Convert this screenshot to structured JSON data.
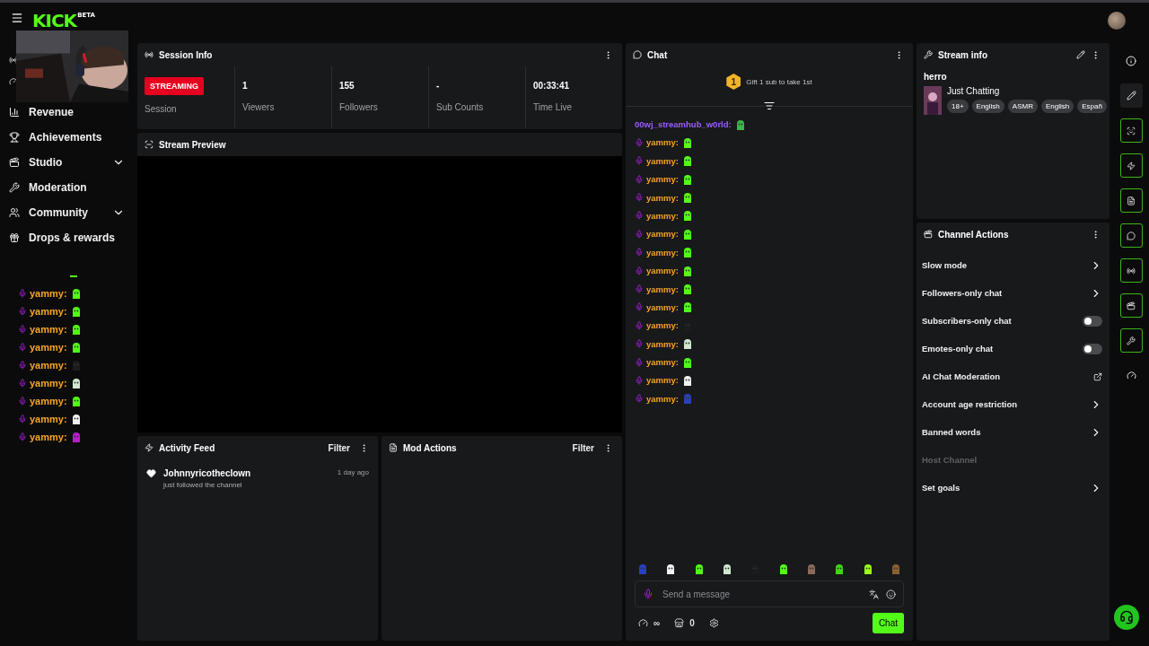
{
  "top_bar": {
    "logo": "KICK",
    "logo_badge": "BETA"
  },
  "sidebar": {
    "items": [
      {
        "label": "Revenue",
        "expandable": false
      },
      {
        "label": "Achievements",
        "expandable": false
      },
      {
        "label": "Studio",
        "expandable": true
      },
      {
        "label": "Moderation",
        "expandable": false
      },
      {
        "label": "Community",
        "expandable": true
      },
      {
        "label": "Drops & rewards",
        "expandable": false
      }
    ]
  },
  "overlay_chat": [
    {
      "user": "yammy:",
      "color": "#53fc18"
    },
    {
      "user": "yammy:",
      "color": "#53fc18"
    },
    {
      "user": "yammy:",
      "color": "#53fc18"
    },
    {
      "user": "yammy:",
      "color": "#53fc18"
    },
    {
      "user": "yammy:",
      "color": "#1c1c1c"
    },
    {
      "user": "yammy:",
      "color": "#cfe8cf"
    },
    {
      "user": "yammy:",
      "color": "#53fc18"
    },
    {
      "user": "yammy:",
      "color": "#f2f2f2"
    },
    {
      "user": "yammy:",
      "color": "#b51fc9"
    }
  ],
  "session_info": {
    "title": "Session Info",
    "stats": [
      {
        "kind": "badge",
        "value": "STREAMING",
        "label": "Session"
      },
      {
        "kind": "number",
        "value": "1",
        "label": "Viewers"
      },
      {
        "kind": "number",
        "value": "155",
        "label": "Followers"
      },
      {
        "kind": "number",
        "value": "-",
        "label": "Sub Counts"
      },
      {
        "kind": "number",
        "value": "00:33:41",
        "label": "Time Live"
      }
    ]
  },
  "stream_preview": {
    "title": "Stream Preview"
  },
  "activity_feed": {
    "title": "Activity Feed",
    "filter": "Filter",
    "items": [
      {
        "user": "Johnnyricotheclown",
        "action": "just followed the channel",
        "time": "1 day ago"
      }
    ]
  },
  "mod_actions": {
    "title": "Mod Actions",
    "filter": "Filter"
  },
  "chat": {
    "title": "Chat",
    "leaderboard": {
      "rank": "1",
      "text": "Gift 1 sub to take 1st"
    },
    "messages": [
      {
        "kind": "plain",
        "user": "00wj_streamhub_w0rld:",
        "color": "#3bb54a"
      },
      {
        "kind": "badged",
        "user": "yammy:",
        "color": "#53fc18"
      },
      {
        "kind": "badged",
        "user": "yammy:",
        "color": "#53fc18"
      },
      {
        "kind": "badged",
        "user": "yammy:",
        "color": "#53fc18"
      },
      {
        "kind": "badged",
        "user": "yammy:",
        "color": "#53fc18"
      },
      {
        "kind": "badged",
        "user": "yammy:",
        "color": "#53fc18"
      },
      {
        "kind": "badged",
        "user": "yammy:",
        "color": "#53fc18"
      },
      {
        "kind": "badged",
        "user": "yammy:",
        "color": "#53fc18"
      },
      {
        "kind": "badged",
        "user": "yammy:",
        "color": "#53fc18"
      },
      {
        "kind": "badged",
        "user": "yammy:",
        "color": "#53fc18"
      },
      {
        "kind": "badged",
        "user": "yammy:",
        "color": "#53fc18"
      },
      {
        "kind": "badged",
        "user": "yammy:",
        "color": "#1c1c1c"
      },
      {
        "kind": "badged",
        "user": "yammy:",
        "color": "#cfe8cf"
      },
      {
        "kind": "badged",
        "user": "yammy:",
        "color": "#53fc18"
      },
      {
        "kind": "badged",
        "user": "yammy:",
        "color": "#f2f2f2"
      },
      {
        "kind": "badged",
        "user": "yammy:",
        "color": "#2a3fc0"
      }
    ],
    "emote_bar": [
      {
        "color": "#2a3fc0"
      },
      {
        "color": "#f2f2f2"
      },
      {
        "color": "#53fc18"
      },
      {
        "color": "#cfe8cf"
      },
      {
        "color": "#1c1c1c"
      },
      {
        "color": "#53fc19"
      },
      {
        "color": "#8a6a5a"
      },
      {
        "color": "#3fd61a"
      },
      {
        "color": "#9cfc18"
      },
      {
        "color": "#8a6030"
      }
    ],
    "input": {
      "placeholder": "Send a message"
    },
    "points": "∞",
    "count": "0",
    "send": "Chat"
  },
  "stream_info": {
    "title": "Stream info",
    "stream_title": "herro",
    "category": "Just Chatting",
    "tags": [
      "18+",
      "English",
      "ASMR",
      "English",
      "Españ"
    ]
  },
  "channel_actions": {
    "title": "Channel Actions",
    "items": [
      {
        "kind": "chevron",
        "label": "Slow mode",
        "disabled": false
      },
      {
        "kind": "chevron",
        "label": "Followers-only chat",
        "disabled": false
      },
      {
        "kind": "toggle",
        "label": "Subscribers-only chat",
        "on": false,
        "disabled": false
      },
      {
        "kind": "toggle",
        "label": "Emotes-only chat",
        "on": false,
        "disabled": false
      },
      {
        "kind": "external",
        "label": "AI Chat Moderation",
        "disabled": false
      },
      {
        "kind": "chevron",
        "label": "Account age restriction",
        "disabled": false
      },
      {
        "kind": "chevron",
        "label": "Banned words",
        "disabled": false
      },
      {
        "kind": "plain",
        "label": "Host Channel",
        "disabled": true
      },
      {
        "kind": "chevron",
        "label": "Set goals",
        "disabled": false
      }
    ]
  }
}
